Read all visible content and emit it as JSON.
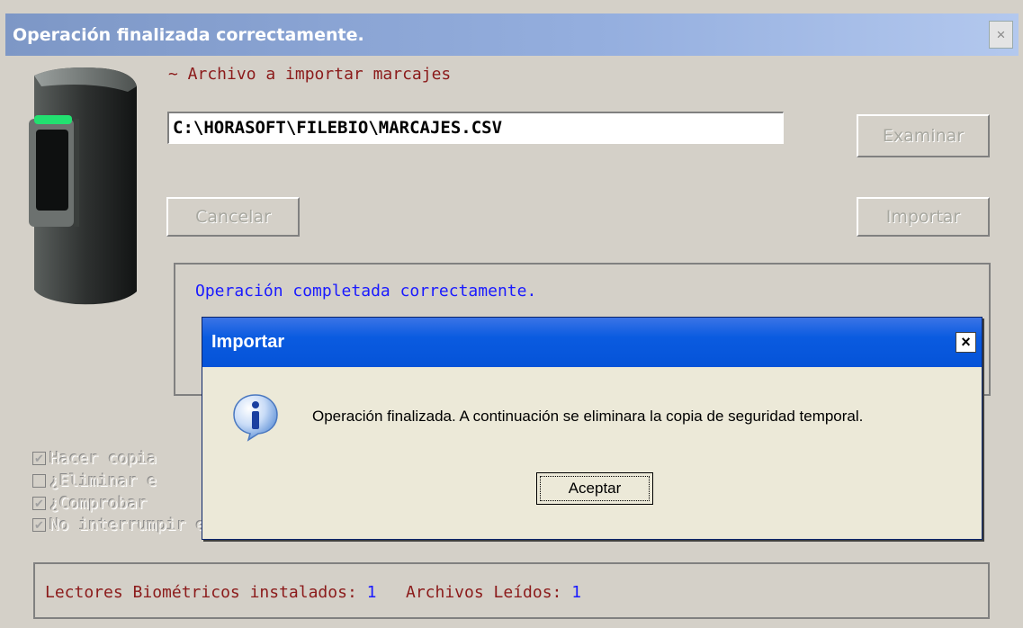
{
  "window": {
    "title": "Operación finalizada correctamente.",
    "close_glyph": "×"
  },
  "import_section": {
    "label": "~ Archivo a importar marcajes",
    "file_path": "C:\\HORASOFT\\FILEBIO\\MARCAJES.CSV",
    "browse_label": "Examinar",
    "cancel_label": "Cancelar",
    "import_label": "Importar"
  },
  "status": {
    "message": "Operación completada correctamente."
  },
  "options": [
    {
      "label": "Hacer copia",
      "checked": true
    },
    {
      "label": "¿Eliminar e",
      "checked": false
    },
    {
      "label": "¿Comprobar",
      "checked": true
    },
    {
      "label": "No interrumpir en caso de empleados no localizados",
      "checked": true
    }
  ],
  "footer": {
    "readers_label": "Lectores Biométricos instalados:",
    "readers_count": "1",
    "files_label": "Archivos Leídos:",
    "files_count": "1"
  },
  "dialog": {
    "title": "Importar",
    "close_glyph": "×",
    "icon": "info-icon",
    "message": "Operación finalizada. A continuación se eliminara la copia de seguridad temporal.",
    "ok_label": "Aceptar"
  },
  "colors": {
    "dialog_title_bar": "#0553d8",
    "window_title_bar": "#7d97c6",
    "status_text": "#1a1aff",
    "label_text": "#8b1a1a"
  }
}
